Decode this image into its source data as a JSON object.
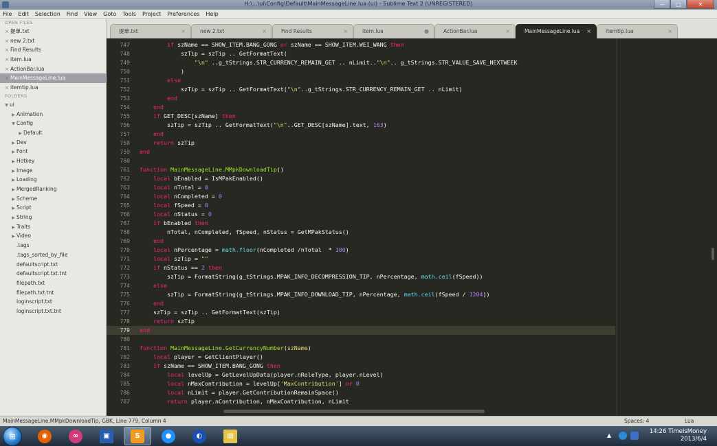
{
  "window": {
    "title": "H:\\...\\ui\\Config\\Default\\MainMessageLine.lua (ui) - Sublime Text 2 (UNREGISTERED)"
  },
  "menu": [
    "File",
    "Edit",
    "Selection",
    "Find",
    "View",
    "Goto",
    "Tools",
    "Project",
    "Preferences",
    "Help"
  ],
  "sidebar": {
    "open_files_header": "OPEN FILES",
    "open_files": [
      "提单.txt",
      "new 2.txt",
      "Find Results",
      "item.lua",
      "ActionBar.lua",
      "MainMessageLine.lua",
      "itemtip.lua"
    ],
    "folders_header": "FOLDERS",
    "folders": [
      {
        "label": "ui",
        "depth": 0,
        "tri": "▼"
      },
      {
        "label": "Animation",
        "depth": 1,
        "tri": "▶"
      },
      {
        "label": "Config",
        "depth": 1,
        "tri": "▼"
      },
      {
        "label": "Default",
        "depth": 2,
        "tri": "▶"
      },
      {
        "label": "Dev",
        "depth": 1,
        "tri": "▶"
      },
      {
        "label": "Font",
        "depth": 1,
        "tri": "▶"
      },
      {
        "label": "Hotkey",
        "depth": 1,
        "tri": "▶"
      },
      {
        "label": "Image",
        "depth": 1,
        "tri": "▶"
      },
      {
        "label": "Loading",
        "depth": 1,
        "tri": "▶"
      },
      {
        "label": "MergedRanking",
        "depth": 1,
        "tri": "▶"
      },
      {
        "label": "Scheme",
        "depth": 1,
        "tri": "▶"
      },
      {
        "label": "Script",
        "depth": 1,
        "tri": "▶"
      },
      {
        "label": "String",
        "depth": 1,
        "tri": "▶"
      },
      {
        "label": "Traits",
        "depth": 1,
        "tri": "▶"
      },
      {
        "label": "Video",
        "depth": 1,
        "tri": "▶"
      },
      {
        "label": ".tags",
        "depth": 1,
        "tri": ""
      },
      {
        "label": ".tags_sorted_by_file",
        "depth": 1,
        "tri": ""
      },
      {
        "label": "defaultscript.txt",
        "depth": 1,
        "tri": ""
      },
      {
        "label": "defaultscript.txt.tnt",
        "depth": 1,
        "tri": ""
      },
      {
        "label": "filepath.txt",
        "depth": 1,
        "tri": ""
      },
      {
        "label": "filepath.txt.tnt",
        "depth": 1,
        "tri": ""
      },
      {
        "label": "loginscript.txt",
        "depth": 1,
        "tri": ""
      },
      {
        "label": "loginscript.txt.tnt",
        "depth": 1,
        "tri": ""
      }
    ]
  },
  "tabs": [
    {
      "label": "提单.txt",
      "close": "×"
    },
    {
      "label": "new 2.txt",
      "close": "×"
    },
    {
      "label": "Find Results",
      "close": "×"
    },
    {
      "label": "item.lua",
      "close": "●"
    },
    {
      "label": "ActionBar.lua",
      "close": "×"
    },
    {
      "label": "MainMessageLine.lua",
      "close": "×",
      "active": true
    },
    {
      "label": "itemtip.lua",
      "close": "×"
    }
  ],
  "editor": {
    "current_line": "779",
    "lines": [
      {
        "n": "747",
        "c": [
          [
            "k",
            "        if "
          ],
          [
            "",
            "szName == SHOW_ITEM.BANG_GONG "
          ],
          [
            "k",
            "or"
          ],
          [
            "",
            " szName == SHOW_ITEM.WEI_WANG "
          ],
          [
            "k",
            "then"
          ]
        ]
      },
      {
        "n": "748",
        "c": [
          [
            "",
            "            szTip = szTip .. GetFormatText("
          ]
        ]
      },
      {
        "n": "749",
        "c": [
          [
            "",
            "                "
          ],
          [
            "s",
            "\"\\n\""
          ],
          [
            "",
            " ..g_tStrings.STR_CURRENCY_REMAIN_GET .. nLimit.."
          ],
          [
            "s",
            "\"\\n\""
          ],
          [
            "",
            ".. g_tStrings.STR_VALUE_SAVE_NEXTWEEK"
          ]
        ]
      },
      {
        "n": "750",
        "c": [
          [
            "",
            "            )"
          ]
        ]
      },
      {
        "n": "751",
        "c": [
          [
            "k",
            "        else"
          ]
        ]
      },
      {
        "n": "752",
        "c": [
          [
            "",
            "            szTip = szTip .. GetFormatText("
          ],
          [
            "s",
            "\"\\n\""
          ],
          [
            "",
            "..g_tStrings.STR_CURRENCY_REMAIN_GET .. nLimit)"
          ]
        ]
      },
      {
        "n": "753",
        "c": [
          [
            "k",
            "        end"
          ]
        ]
      },
      {
        "n": "754",
        "c": [
          [
            "k",
            "    end"
          ]
        ]
      },
      {
        "n": "755",
        "c": [
          [
            "k",
            "    if "
          ],
          [
            "",
            "GET_DESC[szName] "
          ],
          [
            "k",
            "then"
          ]
        ]
      },
      {
        "n": "756",
        "c": [
          [
            "",
            "        szTip = szTip .. GetFormatText("
          ],
          [
            "s",
            "\"\\n\""
          ],
          [
            "",
            "..GET_DESC[szName].text, "
          ],
          [
            "n",
            "163"
          ],
          [
            "",
            ")"
          ]
        ]
      },
      {
        "n": "757",
        "c": [
          [
            "k",
            "    end"
          ]
        ]
      },
      {
        "n": "758",
        "c": [
          [
            "k",
            "    return "
          ],
          [
            "",
            "szTip"
          ]
        ]
      },
      {
        "n": "759",
        "c": [
          [
            "k",
            "end"
          ]
        ]
      },
      {
        "n": "760",
        "c": []
      },
      {
        "n": "761",
        "c": [
          [
            "k",
            "function "
          ],
          [
            "f",
            "MainMessageLine.MMpkDownloadTip"
          ],
          [
            "",
            "()"
          ]
        ]
      },
      {
        "n": "762",
        "c": [
          [
            "k",
            "    local "
          ],
          [
            "",
            "bEnabled = IsMPakEnabled()"
          ]
        ]
      },
      {
        "n": "763",
        "c": [
          [
            "k",
            "    local "
          ],
          [
            "",
            "nTotal = "
          ],
          [
            "n",
            "0"
          ]
        ]
      },
      {
        "n": "764",
        "c": [
          [
            "k",
            "    local "
          ],
          [
            "",
            "nCompleted = "
          ],
          [
            "n",
            "0"
          ]
        ]
      },
      {
        "n": "765",
        "c": [
          [
            "k",
            "    local "
          ],
          [
            "",
            "fSpeed = "
          ],
          [
            "n",
            "0"
          ]
        ]
      },
      {
        "n": "766",
        "c": [
          [
            "k",
            "    local "
          ],
          [
            "",
            "nStatus = "
          ],
          [
            "n",
            "0"
          ]
        ]
      },
      {
        "n": "767",
        "c": [
          [
            "k",
            "    if "
          ],
          [
            "",
            "bEnabled "
          ],
          [
            "k",
            "then"
          ]
        ]
      },
      {
        "n": "768",
        "c": [
          [
            "",
            "        nTotal, nCompleted, fSpeed, nStatus = GetMPakStatus()"
          ]
        ]
      },
      {
        "n": "769",
        "c": [
          [
            "k",
            "    end"
          ]
        ]
      },
      {
        "n": "770",
        "c": [
          [
            "k",
            "    local "
          ],
          [
            "",
            "nPercentage = "
          ],
          [
            "b",
            "math.floor"
          ],
          [
            "",
            "(nCompleted /nTotal  * "
          ],
          [
            "n",
            "100"
          ],
          [
            "",
            ")"
          ]
        ]
      },
      {
        "n": "771",
        "c": [
          [
            "k",
            "    local "
          ],
          [
            "",
            "szTip = "
          ],
          [
            "s",
            "\"\""
          ]
        ]
      },
      {
        "n": "772",
        "c": [
          [
            "k",
            "    if "
          ],
          [
            "",
            "nStatus == "
          ],
          [
            "n",
            "2"
          ],
          [
            "k",
            " then"
          ]
        ]
      },
      {
        "n": "773",
        "c": [
          [
            "",
            "        szTip = FormatString(g_tStrings.MPAK_INFO_DECOMPRESSION_TIP, nPercentage, "
          ],
          [
            "b",
            "math.ceil"
          ],
          [
            "",
            "(fSpeed))"
          ]
        ]
      },
      {
        "n": "774",
        "c": [
          [
            "k",
            "    else"
          ]
        ]
      },
      {
        "n": "775",
        "c": [
          [
            "",
            "        szTip = FormatString(g_tStrings.MPAK_INFO_DOWNLOAD_TIP, nPercentage, "
          ],
          [
            "b",
            "math.ceil"
          ],
          [
            "",
            "(fSpeed / "
          ],
          [
            "n",
            "1204"
          ],
          [
            "",
            "))"
          ]
        ]
      },
      {
        "n": "776",
        "c": [
          [
            "k",
            "    end"
          ]
        ]
      },
      {
        "n": "777",
        "c": [
          [
            "",
            "    szTip = szTip .. GetFormatText(szTip)"
          ]
        ]
      },
      {
        "n": "778",
        "c": [
          [
            "k",
            "    return "
          ],
          [
            "",
            "szTip"
          ]
        ]
      },
      {
        "n": "779",
        "c": [
          [
            "k",
            "end"
          ]
        ]
      },
      {
        "n": "780",
        "c": []
      },
      {
        "n": "781",
        "c": [
          [
            "k",
            "function "
          ],
          [
            "f",
            "MainMessageLine.GetCurrencyNumber"
          ],
          [
            "",
            "("
          ],
          [
            "s",
            "szName"
          ],
          [
            "",
            ")"
          ]
        ]
      },
      {
        "n": "782",
        "c": [
          [
            "k",
            "    local "
          ],
          [
            "",
            "player = GetClientPlayer()"
          ]
        ]
      },
      {
        "n": "783",
        "c": [
          [
            "k",
            "    if "
          ],
          [
            "",
            "szName == SHOW_ITEM.BANG_GONG "
          ],
          [
            "k",
            "then"
          ]
        ]
      },
      {
        "n": "784",
        "c": [
          [
            "k",
            "        local "
          ],
          [
            "",
            "levelUp = GetLevelUpData(player.nRoleType, player.nLevel)"
          ]
        ]
      },
      {
        "n": "785",
        "c": [
          [
            "k",
            "        local "
          ],
          [
            "",
            "nMaxContribution = levelUp["
          ],
          [
            "s",
            "'MaxContribution'"
          ],
          [
            "",
            "] "
          ],
          [
            "k",
            "or "
          ],
          [
            "n",
            "0"
          ]
        ]
      },
      {
        "n": "786",
        "c": [
          [
            "k",
            "        local "
          ],
          [
            "",
            "nLimit = player.GetContributionRemainSpace()"
          ]
        ]
      },
      {
        "n": "787",
        "c": [
          [
            "k",
            "        return "
          ],
          [
            "",
            "player.nContribution, nMaxContribution, nLimit"
          ]
        ]
      }
    ]
  },
  "status": {
    "left": "MainMessageLine.MMpkDownloadTip, GBK, Line 779, Column 4",
    "spaces": "Spaces: 4",
    "syntax": "Lua"
  },
  "taskbar": {
    "apps": [
      {
        "name": "firefox-icon",
        "glyph": "◉",
        "color": "#e66000"
      },
      {
        "name": "media-player-icon",
        "glyph": "∞",
        "color": "#d23b7a"
      },
      {
        "name": "save-app-icon",
        "glyph": "▣",
        "color": "#2a5db0"
      },
      {
        "name": "sublime-text-icon",
        "glyph": "S",
        "color": "#f59a23",
        "active": true
      },
      {
        "name": "qq-icon",
        "glyph": "●",
        "color": "#1e90ff"
      },
      {
        "name": "browser-icon",
        "glyph": "◐",
        "color": "#1a4fb5"
      },
      {
        "name": "file-explorer-icon",
        "glyph": "▤",
        "color": "#e6c34a"
      }
    ],
    "clock_time": "14:26 TimeIsMoney",
    "clock_date": "2013/6/4"
  }
}
